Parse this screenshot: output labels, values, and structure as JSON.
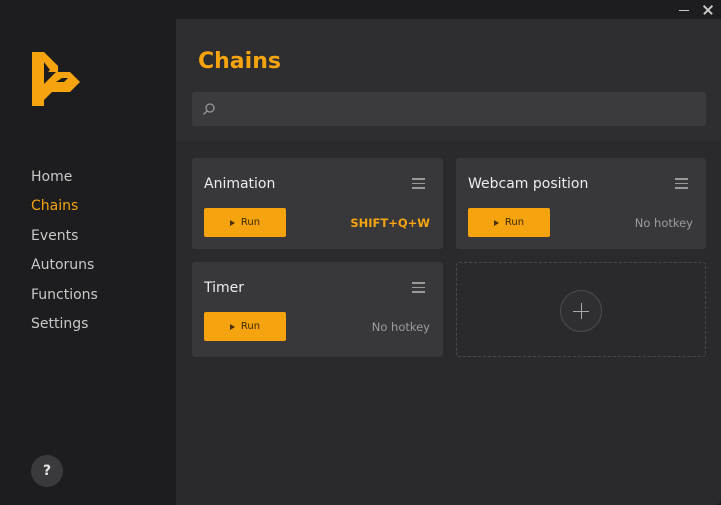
{
  "window": {
    "minimize_icon": "minimize-icon",
    "close_icon": "close-icon"
  },
  "brand": {
    "logo_icon": "app-logo-icon",
    "accent": "#f5a30f"
  },
  "sidebar": {
    "items": [
      {
        "label": "Home",
        "active": false
      },
      {
        "label": "Chains",
        "active": true
      },
      {
        "label": "Events",
        "active": false
      },
      {
        "label": "Autoruns",
        "active": false
      },
      {
        "label": "Functions",
        "active": false
      },
      {
        "label": "Settings",
        "active": false
      }
    ],
    "help_label": "?"
  },
  "main": {
    "title": "Chains",
    "search": {
      "icon": "search-icon",
      "placeholder": "",
      "value": ""
    },
    "cards": [
      {
        "title": "Animation",
        "run_label": "Run",
        "hotkey": "SHIFT+Q+W"
      },
      {
        "title": "Webcam position",
        "run_label": "Run",
        "hotkey": "No hotkey"
      },
      {
        "title": "Timer",
        "run_label": "Run",
        "hotkey": "No hotkey"
      }
    ],
    "add_card_icon": "plus-icon"
  }
}
